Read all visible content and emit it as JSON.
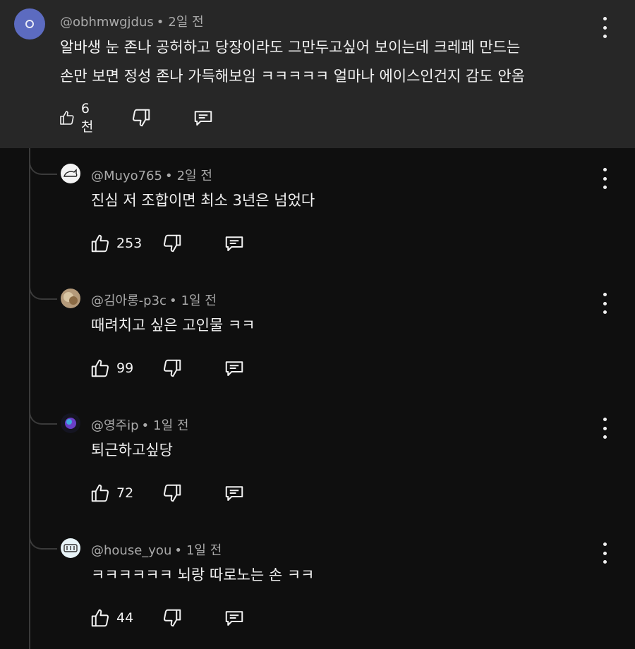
{
  "main": {
    "username": "@obhmwgjdus",
    "time": "2일 전",
    "lines": [
      "알바생 눈 존나 공허하고 당장이라도 그만두고싶어 보이는데 크레페 만드는",
      "손만 보면 정성 존나 가득해보임 ㅋㅋㅋㅋㅋ 얼마나 에이스인건지 감도 안옴"
    ],
    "likes": "6천"
  },
  "replies": [
    {
      "username": "@Muyo765",
      "time": "2일 전",
      "text": "진심 저 조합이면 최소 3년은 넘었다",
      "likes": "253"
    },
    {
      "username": "@김아롱-p3c",
      "time": "1일 전",
      "text": "때려치고 싶은 고인물 ㅋㅋ",
      "likes": "99"
    },
    {
      "username": "@영주ip",
      "time": "1일 전",
      "text": "퇴근하고싶당",
      "likes": "72"
    },
    {
      "username": "@house_you",
      "time": "1일 전",
      "text": "ㅋㅋㅋㅋㅋㅋ 뇌랑 따로노는 손 ㅋㅋ",
      "likes": "44"
    }
  ],
  "colors": {
    "main_bg": "#272727",
    "page_bg": "#0f0f0f",
    "meta": "#aaaaaa",
    "main_avatar": "#5c6bc0"
  },
  "icons": [
    "like-icon",
    "dislike-icon",
    "reply-icon",
    "more-vert-icon"
  ]
}
